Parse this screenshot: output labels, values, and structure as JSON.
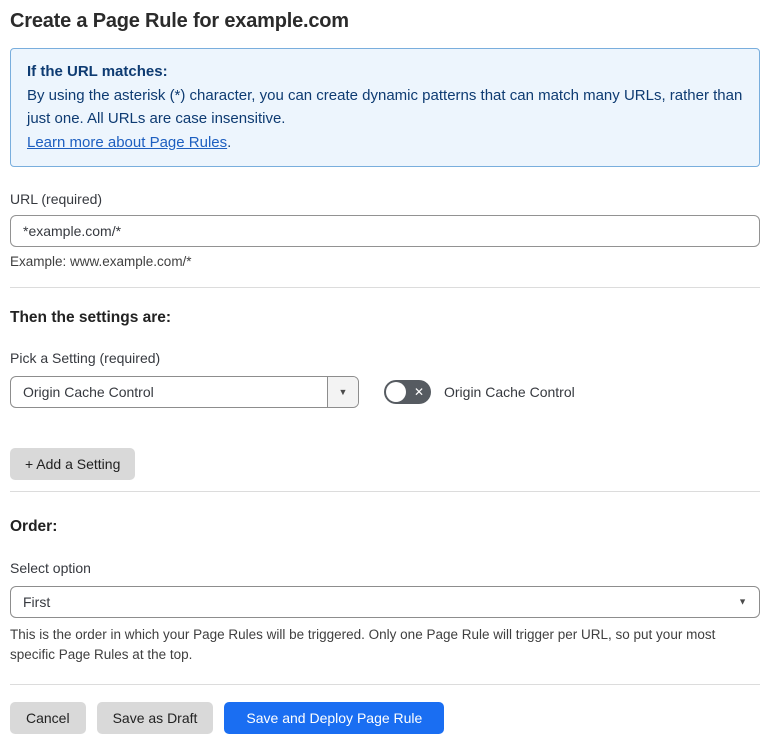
{
  "page": {
    "title": "Create a Page Rule for example.com"
  },
  "info_box": {
    "heading": "If the URL matches:",
    "body": "By using the asterisk (*) character, you can create dynamic patterns that can match many URLs, rather than just one. All URLs are case insensitive.",
    "link_text": "Learn more about Page Rules",
    "link_suffix": "."
  },
  "url_field": {
    "label": "URL (required)",
    "value": "*example.com/*",
    "helper": "Example: www.example.com/*"
  },
  "settings_section": {
    "heading": "Then the settings are:",
    "picker_label": "Pick a Setting (required)",
    "picker_value": "Origin Cache Control",
    "toggle_label": "Origin Cache Control",
    "toggle_state": "off",
    "add_button_label": "+ Add a Setting"
  },
  "order_section": {
    "heading": "Order:",
    "select_label": "Select option",
    "select_value": "First",
    "helper": "This is the order in which your Page Rules will be triggered. Only one Page Rule will trigger per URL, so put your most specific Page Rules at the top."
  },
  "footer": {
    "cancel_label": "Cancel",
    "save_draft_label": "Save as Draft",
    "save_deploy_label": "Save and Deploy Page Rule"
  },
  "icons": {
    "dropdown_caret": "▼",
    "toggle_off_x": "✕"
  },
  "colors": {
    "primary_button": "#1a6ef2",
    "info_box_bg": "#edf5fd",
    "info_box_border": "#79aedd",
    "info_box_text": "#0e3b72",
    "toggle_off_bg": "#565b61"
  }
}
